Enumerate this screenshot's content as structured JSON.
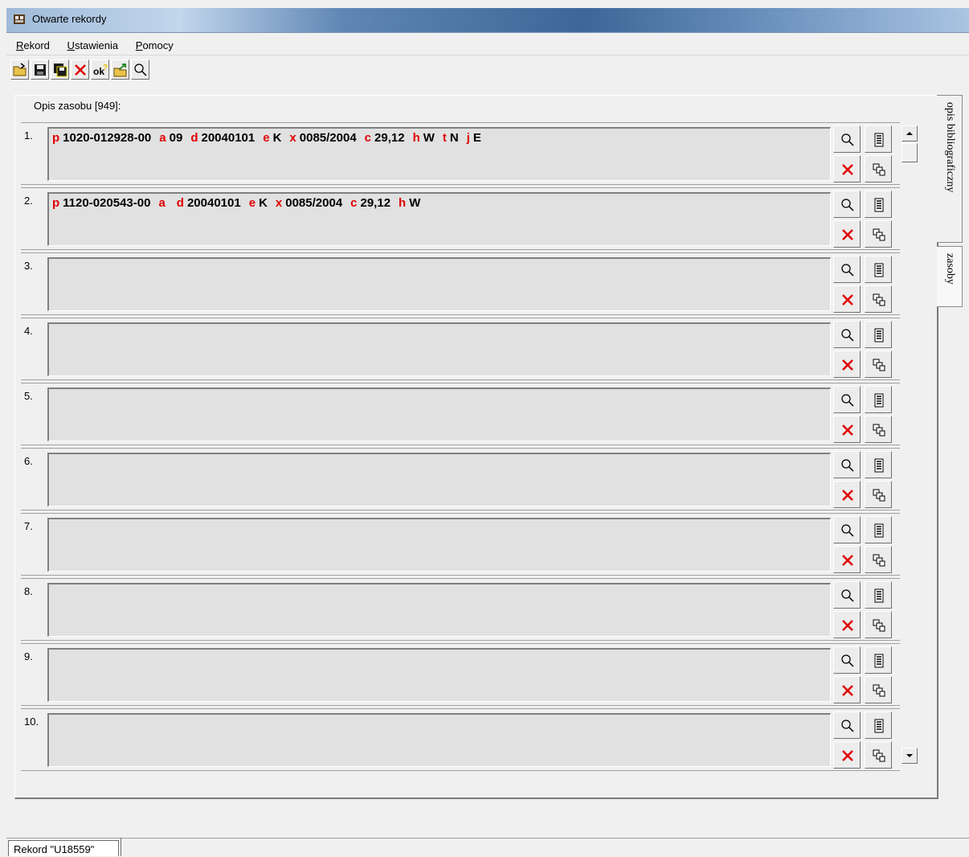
{
  "window": {
    "title": "Otwarte rekordy"
  },
  "menu": [
    {
      "label": "Rekord",
      "accel": "R",
      "rest": "ekord"
    },
    {
      "label": "Ustawienia",
      "accel": "U",
      "rest": "stawienia"
    },
    {
      "label": "Pomocy",
      "accel": "P",
      "rest": "omocy"
    }
  ],
  "toolbar": {
    "buttons": [
      {
        "name": "open-icon"
      },
      {
        "name": "save-icon"
      },
      {
        "name": "save-all-icon"
      },
      {
        "name": "delete-icon"
      },
      {
        "name": "ok-check-icon",
        "text": "ok"
      },
      {
        "name": "export-icon"
      },
      {
        "name": "search-icon"
      }
    ]
  },
  "panel": {
    "label": "Opis zasobu [949]:"
  },
  "rows": [
    {
      "num": "1.",
      "tokens": [
        {
          "code": "p",
          "value": "1020-012928-00"
        },
        {
          "code": "a",
          "value": "09"
        },
        {
          "code": "d",
          "value": "20040101"
        },
        {
          "code": "e",
          "value": "K"
        },
        {
          "code": "x",
          "value": "0085/2004"
        },
        {
          "code": "c",
          "value": "29,12"
        },
        {
          "code": "h",
          "value": "W"
        },
        {
          "code": "t",
          "value": "N"
        },
        {
          "code": "j",
          "value": "E"
        }
      ]
    },
    {
      "num": "2.",
      "tokens": [
        {
          "code": "p",
          "value": "1120-020543-00"
        },
        {
          "code": "a",
          "value": ""
        },
        {
          "code": "d",
          "value": "20040101"
        },
        {
          "code": "e",
          "value": "K"
        },
        {
          "code": "x",
          "value": "0085/2004"
        },
        {
          "code": "c",
          "value": "29,12"
        },
        {
          "code": "h",
          "value": "W"
        }
      ]
    },
    {
      "num": "3.",
      "tokens": []
    },
    {
      "num": "4.",
      "tokens": []
    },
    {
      "num": "5.",
      "tokens": []
    },
    {
      "num": "6.",
      "tokens": []
    },
    {
      "num": "7.",
      "tokens": []
    },
    {
      "num": "8.",
      "tokens": []
    },
    {
      "num": "9.",
      "tokens": []
    },
    {
      "num": "10.",
      "tokens": []
    }
  ],
  "tabs": {
    "side": [
      "opis bibliograficzny",
      "zasoby"
    ],
    "bottom": "Rekord \"U18559\""
  },
  "colors": {
    "subfield_code": "#e00000",
    "field_bg": "#e1e1e1"
  }
}
